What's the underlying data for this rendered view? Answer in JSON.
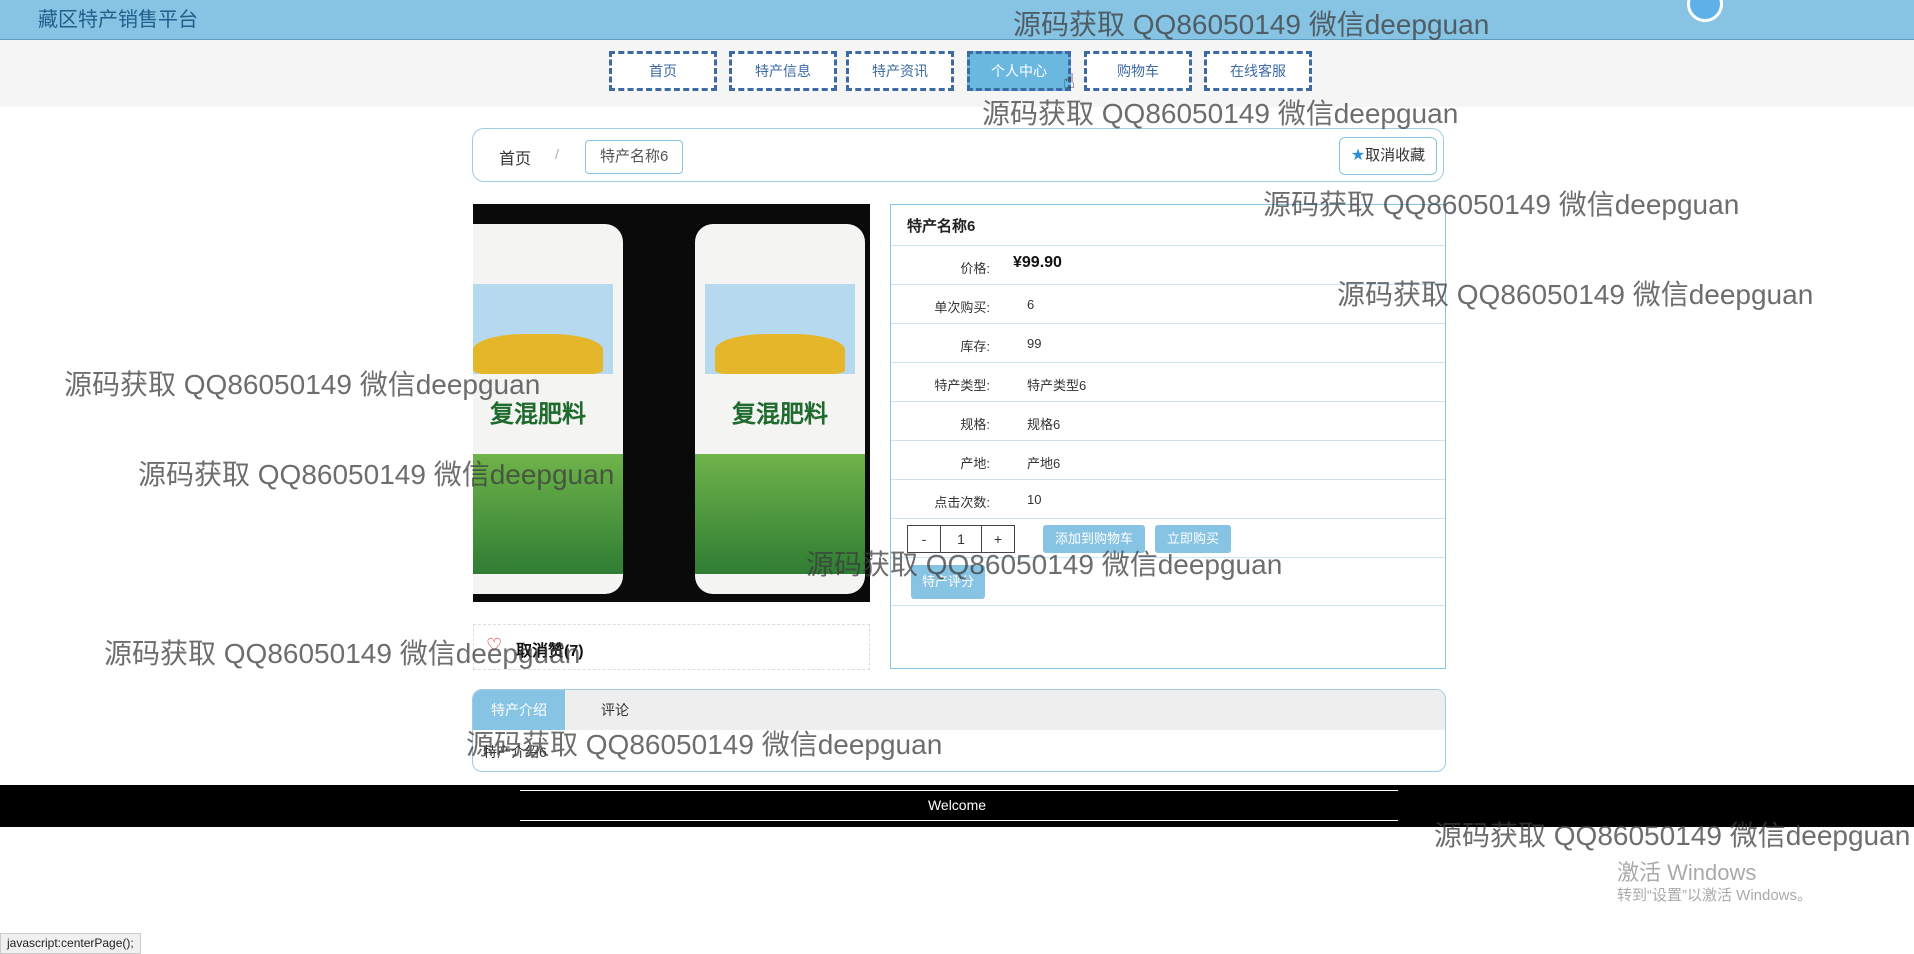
{
  "header": {
    "brand": "藏区特产销售平台"
  },
  "nav": {
    "items": [
      "首页",
      "特产信息",
      "特产资讯",
      "个人中心",
      "购物车",
      "在线客服"
    ],
    "active_index": 3
  },
  "breadcrumb": {
    "home": "首页",
    "separator": "/",
    "current": "特产名称6"
  },
  "favorite": {
    "label": "取消收藏"
  },
  "like": {
    "label": "取消赞(7)"
  },
  "product": {
    "title": "特产名称6",
    "price_label": "价格:",
    "price": "¥99.90",
    "rows": [
      {
        "label": "单次购买:",
        "value": "6"
      },
      {
        "label": "库存:",
        "value": "99"
      },
      {
        "label": "特产类型:",
        "value": "特产类型6"
      },
      {
        "label": "规格:",
        "value": "规格6"
      },
      {
        "label": "产地:",
        "value": "产地6"
      },
      {
        "label": "点击次数:",
        "value": "10"
      }
    ],
    "image_text": "复混肥料"
  },
  "quantity": {
    "minus": "-",
    "value": "1",
    "plus": "+"
  },
  "actions": {
    "add_cart": "添加到购物车",
    "buy_now": "立即购买",
    "review": "特产评分"
  },
  "tabs": {
    "items": [
      "特产介绍",
      "评论"
    ],
    "active_index": 0,
    "content": "特产介绍6"
  },
  "footer": {
    "text": "Welcome"
  },
  "status_bar": {
    "text": "javascript:centerPage();"
  },
  "watermark": {
    "text": "源码获取 QQ86050149 微信deepguan"
  },
  "windows_activation": {
    "title": "激活 Windows",
    "subtitle": "转到“设置”以激活 Windows。"
  }
}
